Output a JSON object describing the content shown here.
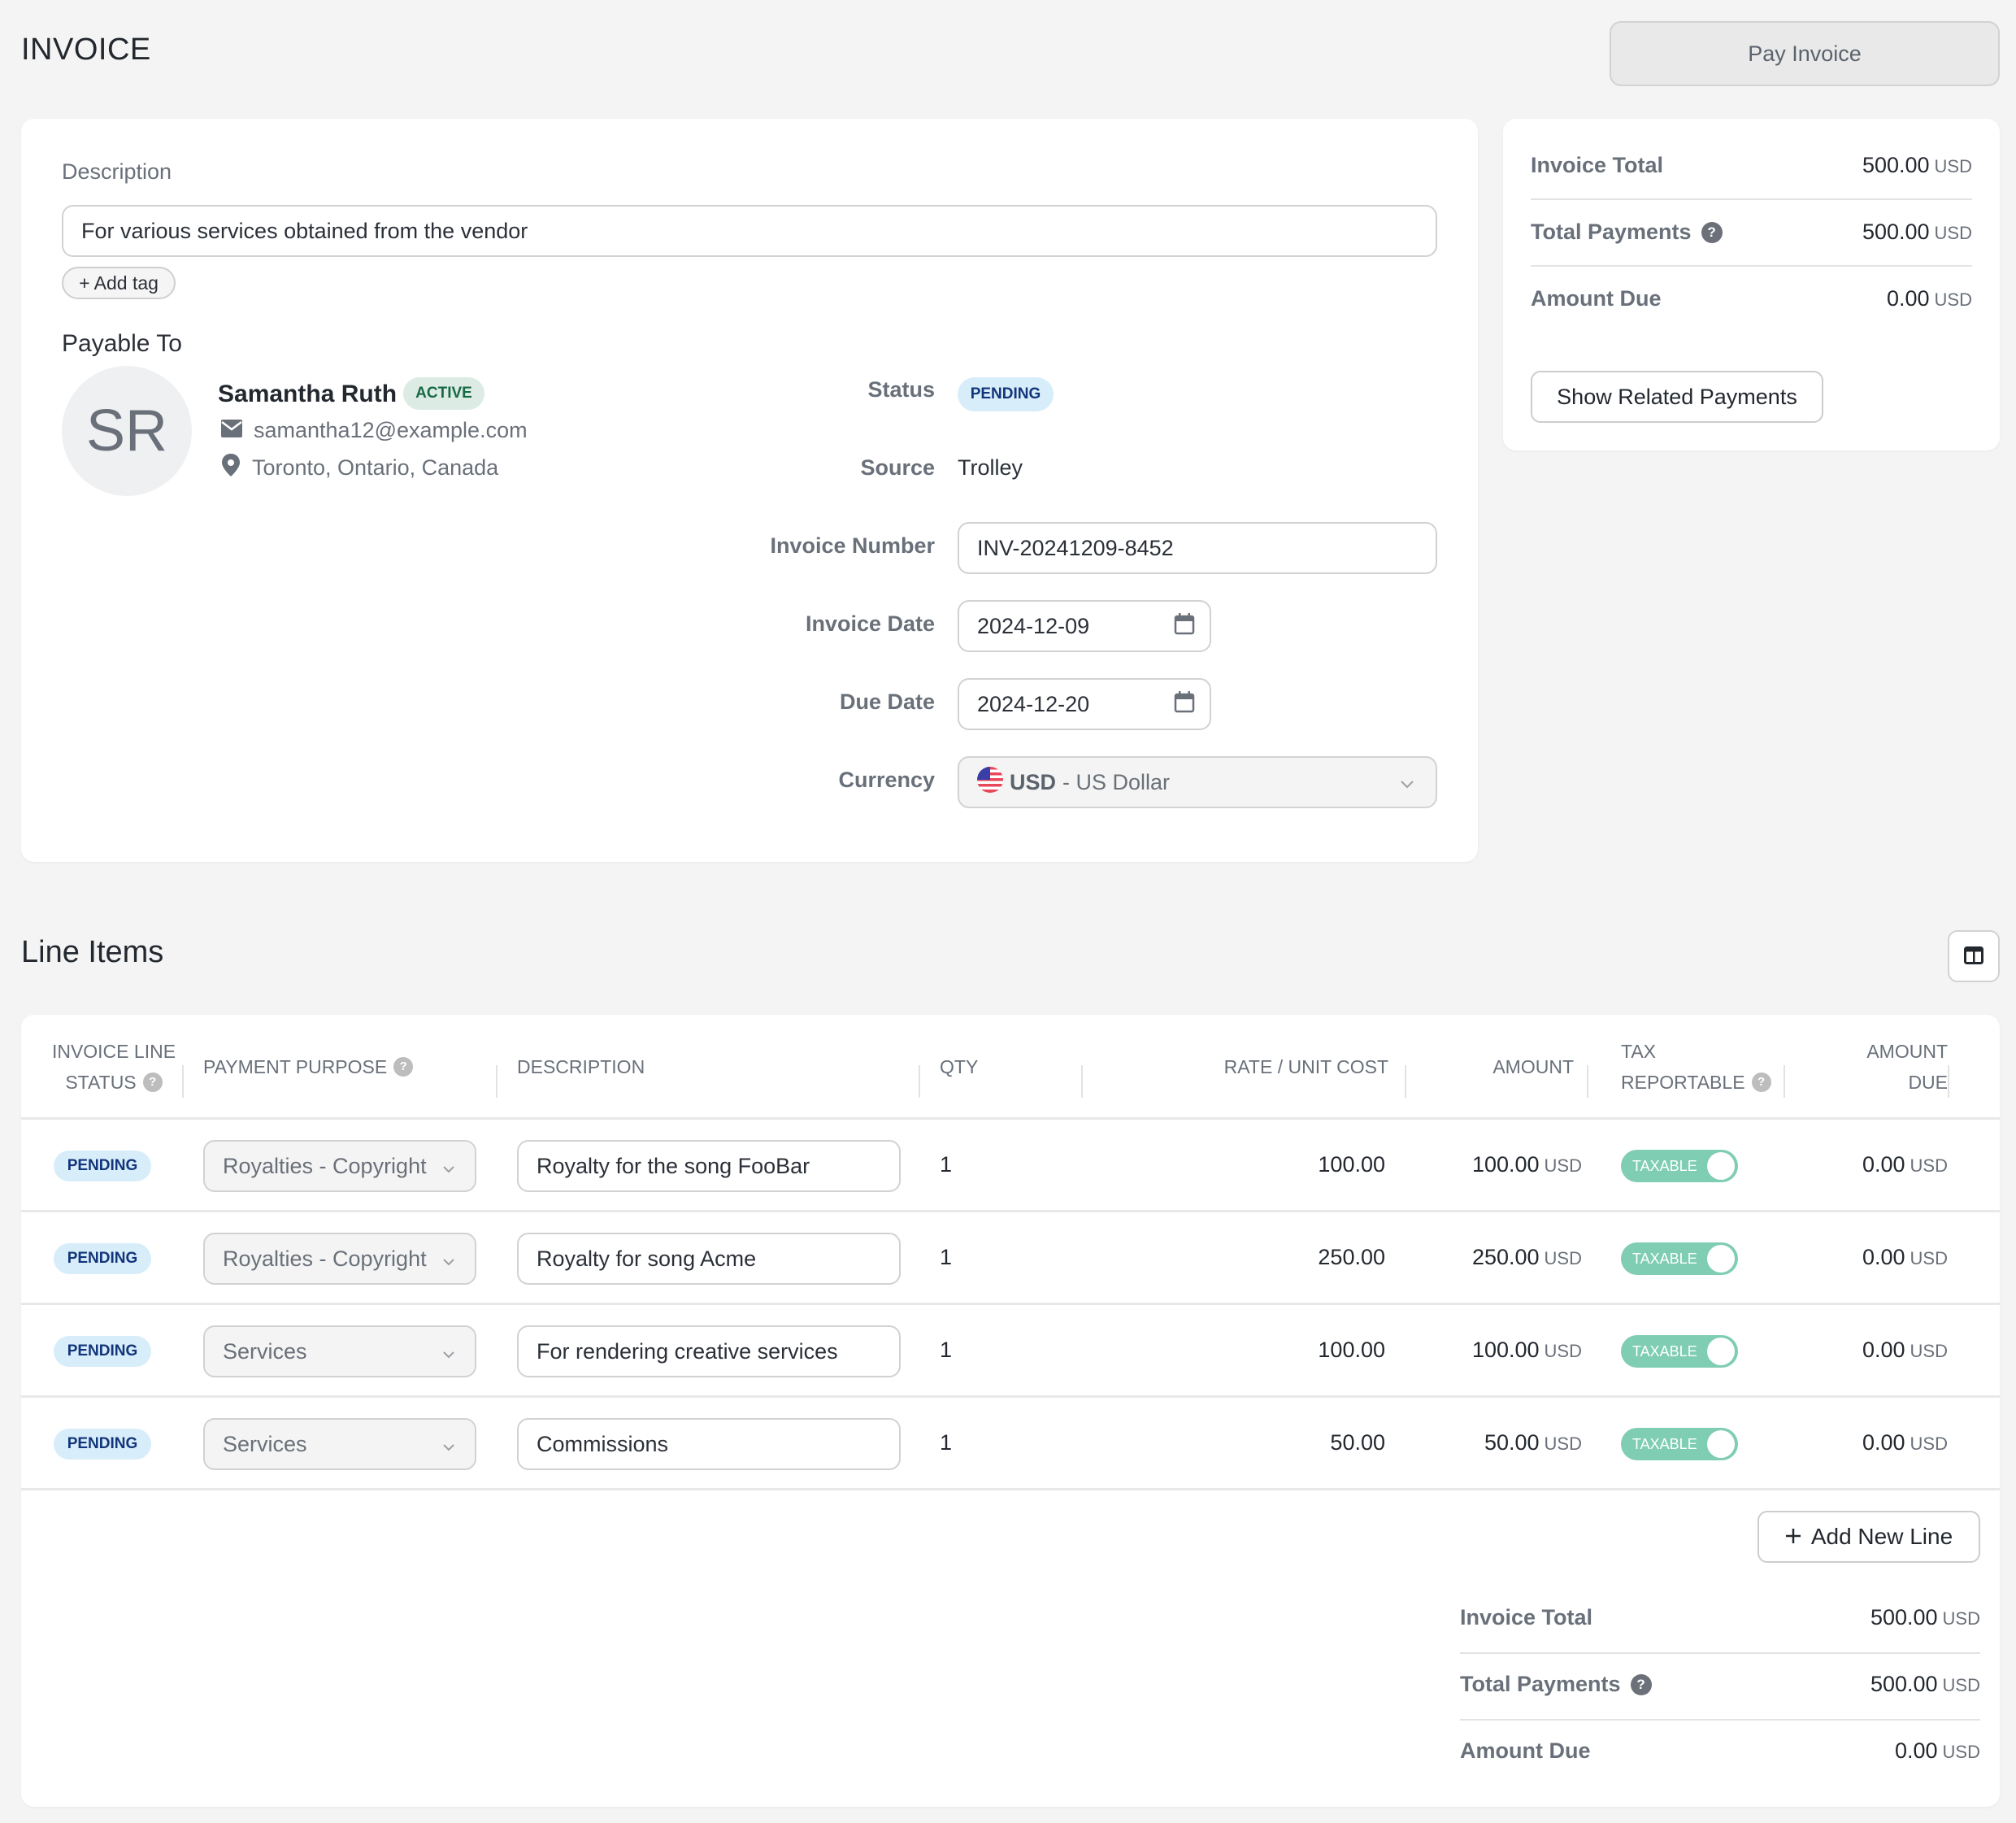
{
  "header": {
    "title": "INVOICE",
    "pay_button": "Pay Invoice"
  },
  "details": {
    "description_label": "Description",
    "description_value": "For various services obtained from the vendor",
    "add_tag_label": "+ Add tag",
    "payable_to_label": "Payable To",
    "payee": {
      "initials": "SR",
      "name": "Samantha Ruth",
      "status": "ACTIVE",
      "email": "samantha12@example.com",
      "location": "Toronto, Ontario, Canada"
    },
    "fields": {
      "status_label": "Status",
      "status_value": "PENDING",
      "source_label": "Source",
      "source_value": "Trolley",
      "invoice_number_label": "Invoice Number",
      "invoice_number_value": "INV-20241209-8452",
      "invoice_date_label": "Invoice Date",
      "invoice_date_value": "2024-12-09",
      "due_date_label": "Due Date",
      "due_date_value": "2024-12-20",
      "currency_label": "Currency",
      "currency_code": "USD",
      "currency_name": " - US Dollar"
    }
  },
  "summary": {
    "invoice_total_label": "Invoice Total",
    "invoice_total_value": "500.00",
    "total_payments_label": "Total Payments",
    "total_payments_value": "500.00",
    "amount_due_label": "Amount Due",
    "amount_due_value": "0.00",
    "unit": "USD",
    "related_payments_button": "Show Related Payments"
  },
  "line_items": {
    "title": "Line Items",
    "columns": {
      "status_1": "INVOICE LINE",
      "status_2": "STATUS",
      "purpose": "PAYMENT PURPOSE",
      "description": "DESCRIPTION",
      "qty": "QTY",
      "rate": "RATE / UNIT COST",
      "amount": "AMOUNT",
      "tax_1": "TAX",
      "tax_2": "REPORTABLE",
      "due_1": "AMOUNT",
      "due_2": "DUE"
    },
    "rows": [
      {
        "status": "PENDING",
        "purpose": "Royalties - Copyright",
        "description": "Royalty for the song FooBar",
        "qty": "1",
        "rate": "100.00",
        "amount": "100.00",
        "unit": "USD",
        "tax": "TAXABLE",
        "amount_due": "0.00"
      },
      {
        "status": "PENDING",
        "purpose": "Royalties - Copyright",
        "description": "Royalty for song Acme",
        "qty": "1",
        "rate": "250.00",
        "amount": "250.00",
        "unit": "USD",
        "tax": "TAXABLE",
        "amount_due": "0.00"
      },
      {
        "status": "PENDING",
        "purpose": "Services",
        "description": "For rendering creative services",
        "qty": "1",
        "rate": "100.00",
        "amount": "100.00",
        "unit": "USD",
        "tax": "TAXABLE",
        "amount_due": "0.00"
      },
      {
        "status": "PENDING",
        "purpose": "Services",
        "description": "Commissions",
        "qty": "1",
        "rate": "50.00",
        "amount": "50.00",
        "unit": "USD",
        "tax": "TAXABLE",
        "amount_due": "0.00"
      }
    ],
    "add_line_button": "Add New Line",
    "totals": {
      "invoice_total_label": "Invoice Total",
      "invoice_total_value": "500.00",
      "total_payments_label": "Total Payments",
      "total_payments_value": "500.00",
      "amount_due_label": "Amount Due",
      "amount_due_value": "0.00",
      "unit": "USD"
    }
  },
  "colors": {
    "pending_bg": "#d8edfa",
    "pending_text": "#12357a",
    "active_bg": "#dcece4",
    "active_text": "#176946",
    "toggle_on": "#7fcdb3"
  }
}
